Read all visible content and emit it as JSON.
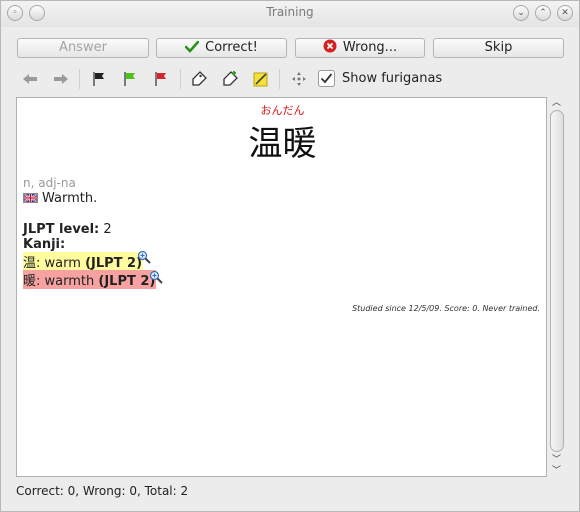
{
  "window": {
    "title": "Training"
  },
  "buttons": {
    "answer": "Answer",
    "correct": "Correct!",
    "wrong": "Wrong...",
    "skip": "Skip"
  },
  "toolbar": {
    "show_furiganas_label": "Show furiganas",
    "show_furiganas_checked": true
  },
  "entry": {
    "furigana": "おんだん",
    "kanji": "温暖",
    "pos": "n, adj-na",
    "meaning": "Warmth.",
    "jlpt_label": "JLPT level:",
    "jlpt_value": "2",
    "kanji_label": "Kanji:",
    "kanji_list": [
      {
        "char": "温",
        "meaning": "warm",
        "jlpt": "(JLPT 2)",
        "color": "#fffb9f"
      },
      {
        "char": "暖",
        "meaning": "warmth",
        "jlpt": "(JLPT 2)",
        "color": "#f7a1a1"
      }
    ],
    "studied": "Studied since 12/5/09. Score: 0. Never trained."
  },
  "status": {
    "text": "Correct: 0, Wrong: 0, Total: 2"
  },
  "icons": [
    "arrow-left-icon",
    "arrow-right-icon",
    "flag-black-icon",
    "flag-green-icon",
    "flag-red-icon",
    "tag-icon",
    "tag-add-icon",
    "note-icon",
    "move-icon",
    "magnifier-icon"
  ]
}
